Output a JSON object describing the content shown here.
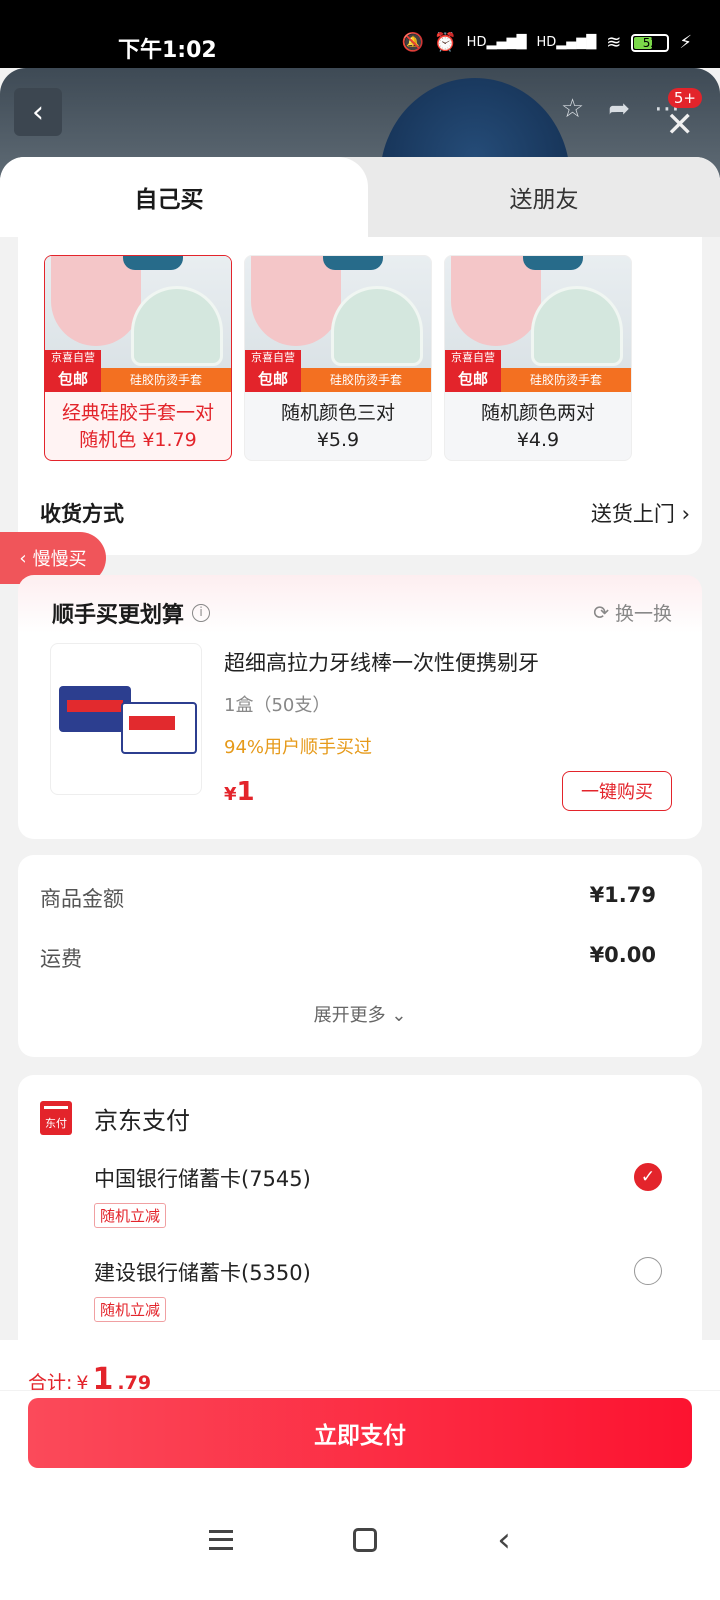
{
  "status_bar": {
    "time": "下午1:02",
    "battery": "52",
    "net1": "HD",
    "net2": "HD"
  },
  "header": {
    "notification_badge": "5+"
  },
  "tabs": {
    "self": "自己买",
    "friend": "送朋友"
  },
  "options": [
    {
      "badge_store": "京喜自营",
      "badge_free": "包邮",
      "banner": "硅胶防烫手套",
      "caption_line1": "经典硅胶手套一对",
      "caption_line2": "随机色 ¥1.79",
      "selected": true
    },
    {
      "badge_store": "京喜自营",
      "badge_free": "包邮",
      "banner": "硅胶防烫手套",
      "caption_line1": "随机颜色三对",
      "caption_line2": "¥5.9",
      "selected": false
    },
    {
      "badge_store": "京喜自营",
      "badge_free": "包邮",
      "banner": "硅胶防烫手套",
      "caption_line1": "随机颜色两对",
      "caption_line2": "¥4.9",
      "selected": false
    }
  ],
  "delivery": {
    "label": "收货方式",
    "value": "送货上门"
  },
  "slow_buy": "慢慢买",
  "addon": {
    "title": "顺手买更划算",
    "swap": "换一换",
    "product_name": "超细高拉力牙线棒一次性便携剔牙",
    "spec": "1盒（50支）",
    "stat": "94%用户顺手买过",
    "price_symbol": "¥",
    "price": "1",
    "buy_button": "一键购买"
  },
  "amount": {
    "goods_label": "商品金额",
    "goods_value": "¥1.79",
    "shipping_label": "运费",
    "shipping_value": "¥0.00",
    "expand": "展开更多"
  },
  "payment": {
    "title": "京东支付",
    "logo_text": "东付",
    "banks": [
      {
        "name": "中国银行储蓄卡(7545)",
        "tag": "随机立减",
        "checked": true
      },
      {
        "name": "建设银行储蓄卡(5350)",
        "tag": "随机立减",
        "checked": false
      }
    ]
  },
  "footer": {
    "total_label": "合计:",
    "total_symbol": "¥",
    "total_int": "1",
    "total_dec": ".79",
    "pay_button": "立即支付"
  }
}
